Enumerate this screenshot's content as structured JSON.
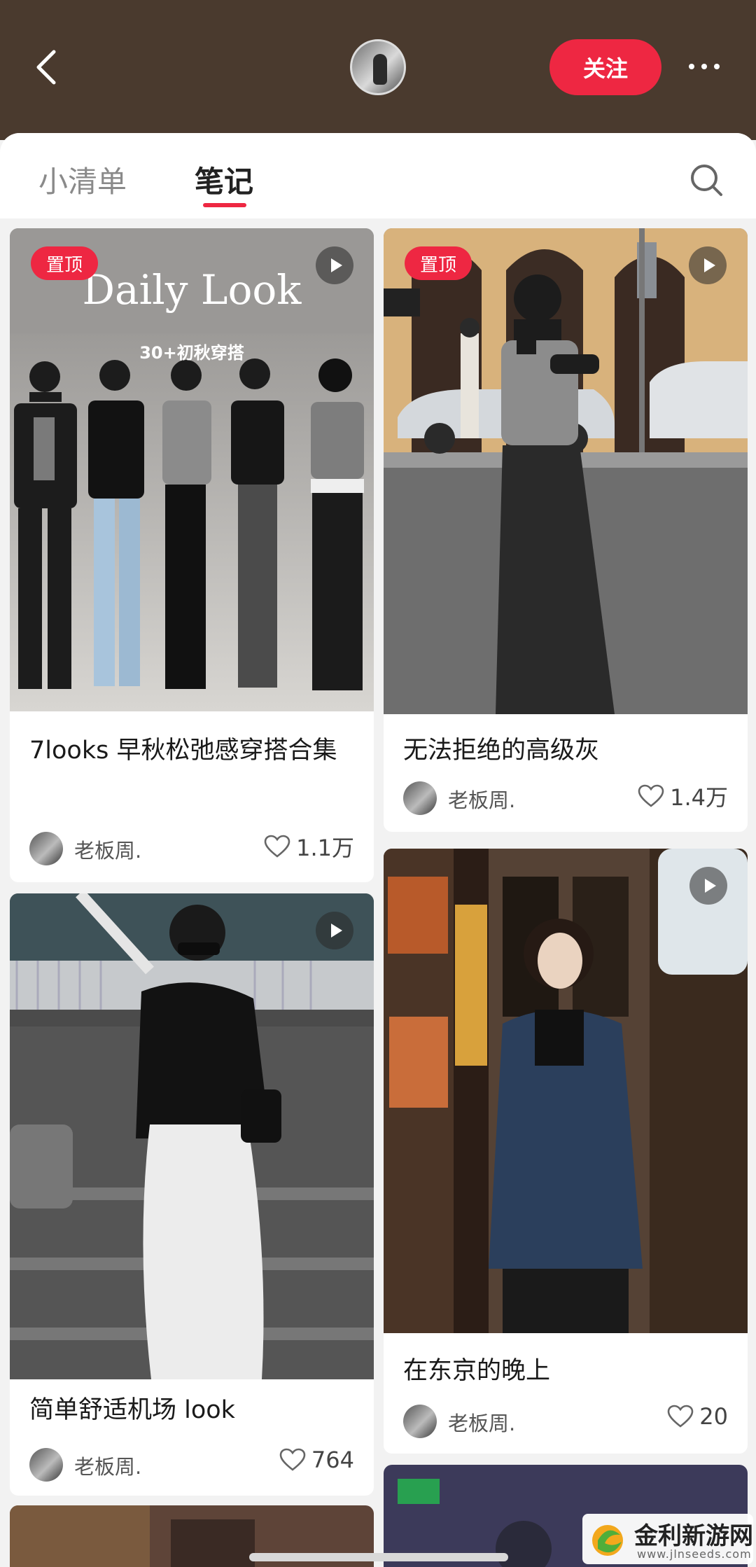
{
  "header": {
    "follow_label": "关注",
    "back_icon": "back-arrow-icon",
    "more_icon": "more-dots-icon"
  },
  "tabs": [
    {
      "label": "小清单",
      "active": false
    },
    {
      "label": "笔记",
      "active": true
    }
  ],
  "colors": {
    "accent": "#ee2742",
    "header_bg": "#4a3a2e"
  },
  "notes": [
    {
      "pin_label": "置顶",
      "video": true,
      "overlay_title": "Daily Look",
      "overlay_subtitle": "30+初秋穿搭",
      "title": "7looks 早秋松弛感穿搭合集",
      "author": "老板周.",
      "likes": "1.1万"
    },
    {
      "pin_label": "置顶",
      "video": true,
      "title": "无法拒绝的高级灰",
      "author": "老板周.",
      "likes": "1.4万"
    },
    {
      "video": true,
      "title": "简单舒适机场 look",
      "author": "老板周.",
      "likes": "764"
    },
    {
      "video": true,
      "title": "在东京的晚上",
      "author": "老板周.",
      "likes": "20"
    }
  ],
  "watermark": {
    "text": "金利新游网",
    "url": "www.jlnseeds.com"
  }
}
